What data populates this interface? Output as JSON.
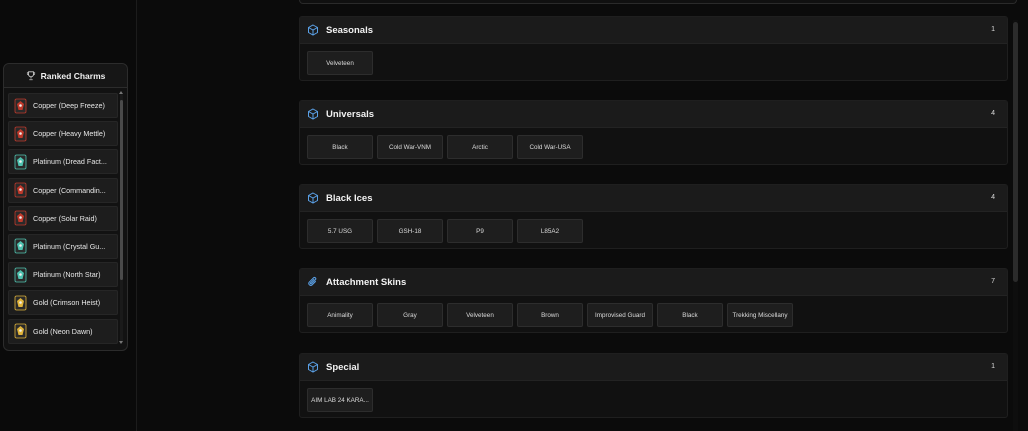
{
  "sidebar": {
    "title": "Ranked Charms",
    "items": [
      {
        "label": "Copper (Deep Freeze)",
        "tier": "copper"
      },
      {
        "label": "Copper (Heavy Mettle)",
        "tier": "copper"
      },
      {
        "label": "Platinum (Dread Fact...",
        "tier": "platinum"
      },
      {
        "label": "Copper (Commandin...",
        "tier": "copper"
      },
      {
        "label": "Copper (Solar Raid)",
        "tier": "copper"
      },
      {
        "label": "Platinum (Crystal Gu...",
        "tier": "platinum"
      },
      {
        "label": "Platinum (North Star)",
        "tier": "platinum"
      },
      {
        "label": "Gold (Crimson Heist)",
        "tier": "gold"
      },
      {
        "label": "Gold (Neon Dawn)",
        "tier": "gold"
      }
    ]
  },
  "sections": [
    {
      "title": "Seasonals",
      "count": "1",
      "icon": "cube-icon",
      "items": [
        "Velveteen"
      ]
    },
    {
      "title": "Universals",
      "count": "4",
      "icon": "cube-icon",
      "items": [
        "Black",
        "Cold War-VNM",
        "Arctic",
        "Cold War-USA"
      ]
    },
    {
      "title": "Black Ices",
      "count": "4",
      "icon": "cube-icon",
      "items": [
        "5.7 USG",
        "GSH-18",
        "P9",
        "L85A2"
      ]
    },
    {
      "title": "Attachment Skins",
      "count": "7",
      "icon": "paperclip-icon",
      "items": [
        "Animality",
        "Gray",
        "Velveteen",
        "Brown",
        "Improvised Guard",
        "Black",
        "Trekking Miscellany"
      ]
    },
    {
      "title": "Special",
      "count": "1",
      "icon": "cube-icon",
      "items": [
        "AIM LAB 24 KARA..."
      ]
    }
  ],
  "colors": {
    "accent_icon": "#5aa0e6",
    "copper": "#c0392b",
    "platinum": "#4fc3b0",
    "gold": "#e0b43a"
  }
}
